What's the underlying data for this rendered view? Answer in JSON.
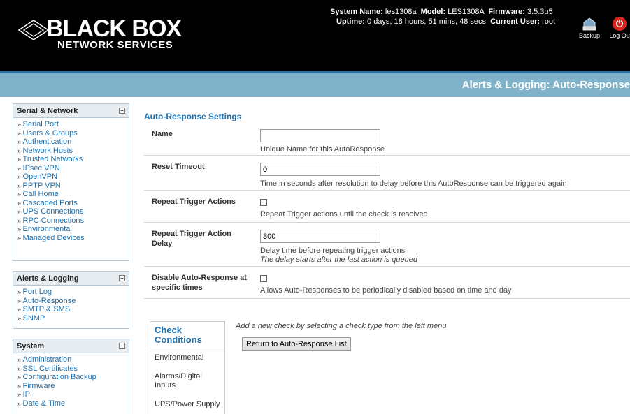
{
  "brand": {
    "line1": "BLACK BOX",
    "line2": "NETWORK SERVICES"
  },
  "system": {
    "name_label": "System Name:",
    "name": "les1308a",
    "model_label": "Model:",
    "model": "LES1308A",
    "firmware_label": "Firmware:",
    "firmware": "3.5.3u5",
    "uptime_label": "Uptime:",
    "uptime": "0 days, 18 hours, 51 mins, 48 secs",
    "user_label": "Current User:",
    "user": "root"
  },
  "header_buttons": {
    "backup": "Backup",
    "logout": "Log Ou"
  },
  "page_title": "Alerts & Logging: Auto-Response",
  "sidebar": {
    "serial_network": {
      "title": "Serial & Network",
      "items": [
        "Serial Port",
        "Users & Groups",
        "Authentication",
        "Network Hosts",
        "Trusted Networks",
        "IPsec VPN",
        "OpenVPN",
        "PPTP VPN",
        "Call Home",
        "Cascaded Ports",
        "UPS Connections",
        "RPC Connections",
        "Environmental",
        "Managed Devices"
      ]
    },
    "alerts_logging": {
      "title": "Alerts & Logging",
      "items": [
        "Port Log",
        "Auto-Response",
        "SMTP & SMS",
        "SNMP"
      ]
    },
    "system": {
      "title": "System",
      "items": [
        "Administration",
        "SSL Certificates",
        "Configuration Backup",
        "Firmware",
        "IP",
        "Date & Time"
      ]
    },
    "arrow": "»",
    "collapse": "−"
  },
  "settings": {
    "title": "Auto-Response Settings",
    "name": {
      "label": "Name",
      "value": "",
      "help": "Unique Name for this AutoResponse"
    },
    "reset_timeout": {
      "label": "Reset Timeout",
      "value": "0",
      "help": "Time in seconds after resolution to delay before this AutoResponse can be triggered again"
    },
    "repeat_trigger": {
      "label": "Repeat Trigger Actions",
      "checked": false,
      "help": "Repeat Trigger actions until the check is resolved"
    },
    "repeat_delay": {
      "label": "Repeat Trigger Action Delay",
      "value": "300",
      "help": "Delay time before repeating trigger actions",
      "help2": "The delay starts after the last action is queued"
    },
    "disable_times": {
      "label": "Disable Auto-Response at specific times",
      "checked": false,
      "help": "Allows Auto-Responses to be periodically disabled based on time and day"
    }
  },
  "check_conditions": {
    "title": "Check Conditions",
    "items": [
      "Environmental",
      "Alarms/Digital Inputs",
      "UPS/Power Supply"
    ]
  },
  "add_hint": "Add a new check by selecting a check type from the left menu",
  "return_button": "Return to Auto-Response List"
}
